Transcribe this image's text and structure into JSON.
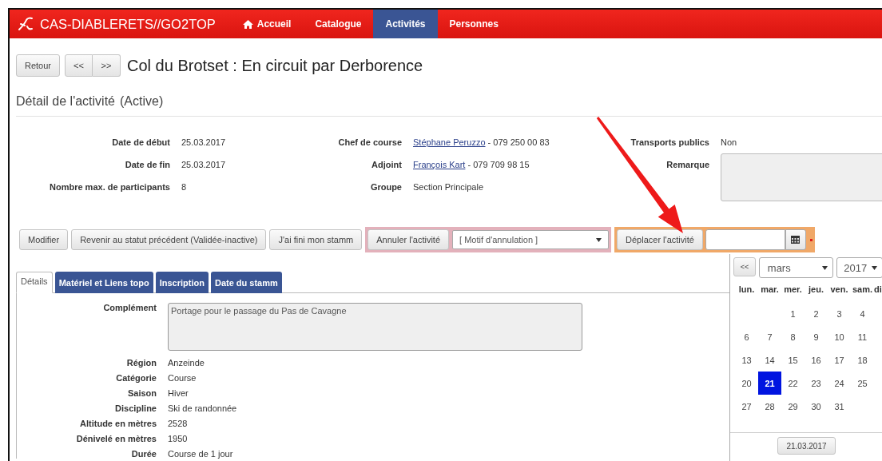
{
  "navbar": {
    "brand": "CAS-DIABLERETS//GO2TOP",
    "items": [
      {
        "label": "Accueil",
        "kind": "home",
        "selected": false
      },
      {
        "label": "Catalogue",
        "selected": false
      },
      {
        "label": "Activités",
        "selected": true
      },
      {
        "label": "Personnes",
        "selected": false
      }
    ]
  },
  "header": {
    "back": "Retour",
    "prev": "<<",
    "next": ">>",
    "title": "Col du Brotset : En circuit par Derborence"
  },
  "section": {
    "title": "Détail de l'activité",
    "status": "(Active)"
  },
  "info_columns": [
    [
      {
        "label": "Date de début",
        "value": "25.03.2017"
      },
      {
        "label": "Date de fin",
        "value": "25.03.2017"
      },
      {
        "label": "Nombre max. de participants",
        "value": "8"
      }
    ],
    [
      {
        "label": "Chef de course",
        "link": "Stéphane Peruzzo",
        "value": " - 079 250 00 83"
      },
      {
        "label": "Adjoint",
        "link": "François Kart",
        "value": " - 079 709 98 15"
      },
      {
        "label": "Groupe",
        "value": "Section Principale"
      }
    ],
    [
      {
        "label": "Transports publics",
        "value": "Non"
      },
      {
        "label": "Remarque",
        "kind": "textarea"
      }
    ]
  ],
  "actions": {
    "buttons": [
      "Modifier",
      "Revenir au statut précédent (Validée-inactive)",
      "J'ai fini mon stamm"
    ],
    "cancel": {
      "button": "Annuler l'activité",
      "select": "[ Motif d'annulation ]"
    },
    "move": {
      "button": "Déplacer l'activité",
      "required": true
    }
  },
  "tabs": [
    {
      "label": "Détails",
      "selected": true
    },
    {
      "label": "Matériel et Liens topo",
      "selected": false
    },
    {
      "label": "Inscription",
      "selected": false
    },
    {
      "label": "Date du stamm",
      "selected": false
    }
  ],
  "details": [
    {
      "label": "Complément",
      "kind": "textarea",
      "value": "Portage pour  le passage du Pas de Cavagne"
    },
    {
      "label": "Région",
      "value": "Anzeinde"
    },
    {
      "label": "Catégorie",
      "value": "Course"
    },
    {
      "label": "Saison",
      "value": "Hiver"
    },
    {
      "label": "Discipline",
      "value": "Ski de randonnée"
    },
    {
      "label": "Altitude en mètres",
      "value": "2528"
    },
    {
      "label": "Dénivelé en mètres",
      "value": "1950"
    },
    {
      "label": "Durée",
      "value": "Course de 1 jour"
    }
  ],
  "calendar": {
    "prev": "<<",
    "month": "mars",
    "year": "2017",
    "weekdays": [
      "lun.",
      "mar.",
      "mer.",
      "jeu.",
      "ven.",
      "sam.",
      "di"
    ],
    "weeks": [
      [
        {
          "kind": "blank"
        },
        {
          "kind": "blank"
        },
        {
          "label": "1",
          "selected": false
        },
        {
          "label": "2",
          "selected": false
        },
        {
          "label": "3",
          "selected": false
        },
        {
          "label": "4",
          "selected": false
        }
      ],
      [
        {
          "label": "6",
          "selected": false
        },
        {
          "label": "7",
          "selected": false
        },
        {
          "label": "8",
          "selected": false
        },
        {
          "label": "9",
          "selected": false
        },
        {
          "label": "10",
          "selected": false
        },
        {
          "label": "11",
          "selected": false
        }
      ],
      [
        {
          "label": "13",
          "selected": false
        },
        {
          "label": "14",
          "selected": false
        },
        {
          "label": "15",
          "selected": false
        },
        {
          "label": "16",
          "selected": false
        },
        {
          "label": "17",
          "selected": false
        },
        {
          "label": "18",
          "selected": false
        }
      ],
      [
        {
          "label": "20",
          "selected": false
        },
        {
          "label": "21",
          "selected": true
        },
        {
          "label": "22",
          "selected": false
        },
        {
          "label": "23",
          "selected": false
        },
        {
          "label": "24",
          "selected": false
        },
        {
          "label": "25",
          "selected": false
        }
      ],
      [
        {
          "label": "27",
          "selected": false
        },
        {
          "label": "28",
          "selected": false
        },
        {
          "label": "29",
          "selected": false
        },
        {
          "label": "30",
          "selected": false
        },
        {
          "label": "31",
          "selected": false
        }
      ]
    ],
    "today": "21.03.2017"
  }
}
